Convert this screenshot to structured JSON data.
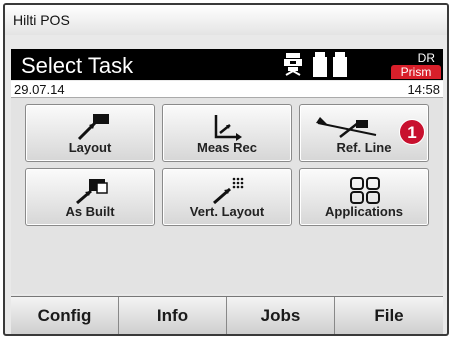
{
  "window": {
    "title": "Hilti POS"
  },
  "header": {
    "title": "Select Task",
    "mode": "DR",
    "target": "Prism"
  },
  "infobar": {
    "date": "29.07.14",
    "time": "14:58"
  },
  "tiles": [
    {
      "label": "Layout",
      "icon": "layout-icon"
    },
    {
      "label": "Meas Rec",
      "icon": "measure-record-icon"
    },
    {
      "label": "Ref. Line",
      "icon": "reference-line-icon"
    },
    {
      "label": "As Built",
      "icon": "as-built-icon"
    },
    {
      "label": "Vert. Layout",
      "icon": "vertical-layout-icon"
    },
    {
      "label": "Applications",
      "icon": "applications-grid-icon"
    }
  ],
  "callout": {
    "number": "1",
    "color": "#c8102e"
  },
  "bottom_bar": [
    {
      "label": "Config"
    },
    {
      "label": "Info"
    },
    {
      "label": "Jobs"
    },
    {
      "label": "File"
    }
  ]
}
